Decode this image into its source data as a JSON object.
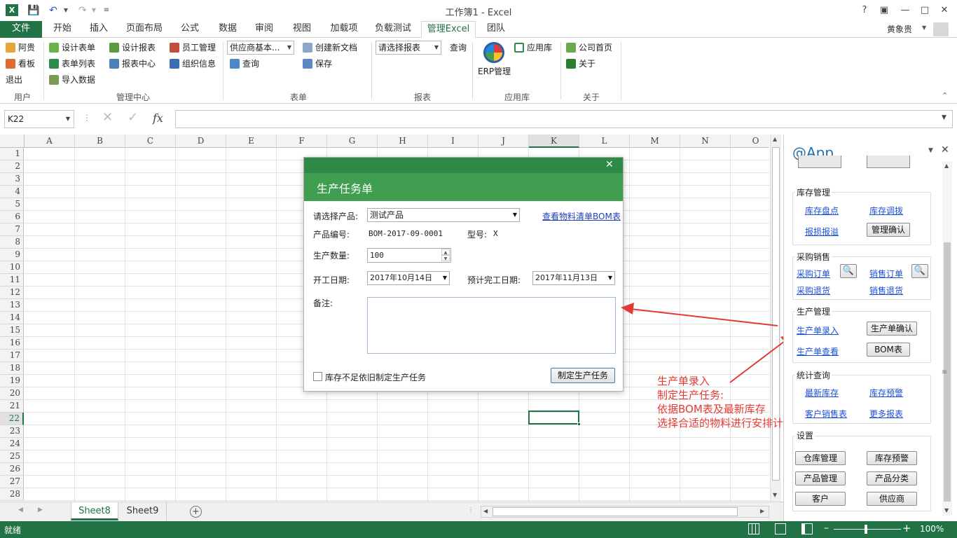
{
  "window": {
    "title": "工作簿1 - Excel",
    "user": "黄象贵"
  },
  "tabs": [
    "文件",
    "开始",
    "插入",
    "页面布局",
    "公式",
    "数据",
    "审阅",
    "视图",
    "加载项",
    "负载测试",
    "管理Excel",
    "团队"
  ],
  "ribbon": {
    "user_group": {
      "items": [
        "阿贵",
        "看板",
        "退出"
      ],
      "label": "用户"
    },
    "mgmt_group": {
      "items": [
        "设计表单",
        "表单列表",
        "导入数据",
        "设计报表",
        "报表中心",
        "员工管理",
        "组织信息"
      ],
      "label": "管理中心"
    },
    "form_group": {
      "combo": "供应商基本...",
      "items": [
        "查询",
        "创建新文档",
        "保存"
      ],
      "label": "表单"
    },
    "report_group": {
      "combo": "请选择报表",
      "items": [
        "查询"
      ],
      "label": "报表"
    },
    "app_group": {
      "erp": "ERP管理",
      "appstore": "应用库",
      "label": "应用库"
    },
    "about_group": {
      "items": [
        "公司首页",
        "关于"
      ],
      "label": "关于"
    }
  },
  "formula_bar": {
    "name_box": "K22",
    "fx": "fx"
  },
  "grid": {
    "columns": [
      "A",
      "B",
      "C",
      "D",
      "E",
      "F",
      "G",
      "H",
      "I",
      "J",
      "K",
      "L",
      "M",
      "N",
      "O"
    ],
    "rows": [
      "1",
      "2",
      "3",
      "4",
      "5",
      "6",
      "7",
      "8",
      "9",
      "10",
      "11",
      "12",
      "13",
      "14",
      "15",
      "16",
      "17",
      "18",
      "19",
      "20",
      "21",
      "22",
      "23",
      "24",
      "25",
      "26",
      "27",
      "28"
    ],
    "selected_cell": "K22"
  },
  "sheets": [
    "Sheet8",
    "Sheet9"
  ],
  "status": {
    "left": "就绪",
    "zoom": "100%"
  },
  "pane": {
    "title": "@App",
    "sections": {
      "inventory": {
        "title": "库存管理",
        "links": [
          "库存盘点",
          "库存调拨",
          "报损报溢"
        ],
        "button": "管理确认"
      },
      "purchase": {
        "title": "采购销售",
        "links": [
          "采购订单",
          "销售订单",
          "采购退货",
          "销售退货"
        ]
      },
      "production": {
        "title": "生产管理",
        "links": [
          "生产单录入",
          "生产单查看"
        ],
        "buttons": [
          "生产单确认",
          "BOM表"
        ]
      },
      "stats": {
        "title": "统计查询",
        "links": [
          "最新库存",
          "库存预警",
          "客户销售表",
          "更多报表"
        ]
      },
      "settings": {
        "title": "设置",
        "buttons": [
          "仓库管理",
          "库存预警",
          "产品管理",
          "产品分类",
          "客户",
          "供应商"
        ]
      }
    }
  },
  "dialog": {
    "title": "生产任务单",
    "product_label": "请选择产品:",
    "product_value": "测试产品",
    "bom_link": "查看物料清单BOM表",
    "code_label": "产品编号:",
    "code_value": "BOM-2017-09-0001",
    "model_label": "型号:",
    "model_value": "X",
    "qty_label": "生产数量:",
    "qty_value": "100",
    "start_label": "开工日期:",
    "start_value": "2017年10月14日",
    "end_label": "预计完工日期:",
    "end_value": "2017年11月13日",
    "note_label": "备注:",
    "checkbox_label": "库存不足依旧制定生产任务",
    "submit": "制定生产任务"
  },
  "annotation": {
    "lines": [
      "生产单录入",
      "制定生产任务:",
      "依据BOM表及最新库存",
      "选择合适的物料进行安排计划"
    ],
    "color": "#e53935"
  },
  "colors": {
    "excel_green": "#217346",
    "dialog_green": "#3f9e4f",
    "link": "#1a4fd8"
  }
}
